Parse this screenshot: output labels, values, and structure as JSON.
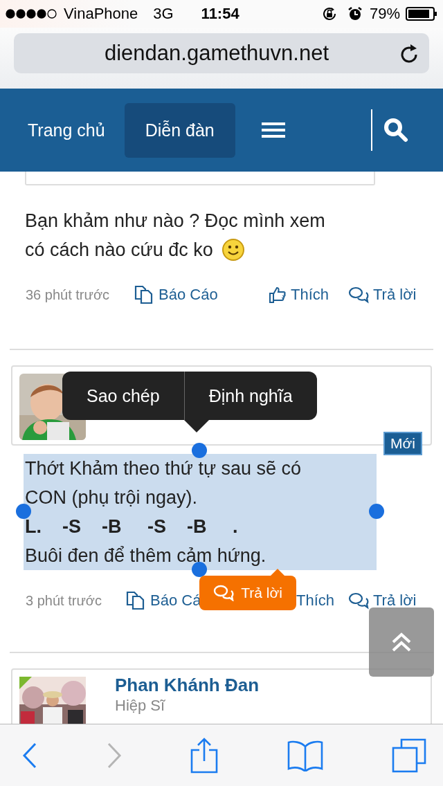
{
  "status_bar": {
    "carrier": "VinaPhone",
    "network": "3G",
    "time": "11:54",
    "battery": "79%"
  },
  "address_bar": {
    "url": "diendan.gamethuvn.net"
  },
  "nav": [
    {
      "label": "Trang chủ",
      "selected": false
    },
    {
      "label": "Diễn đàn",
      "selected": true
    }
  ],
  "posts": [
    {
      "kind": "body",
      "selected": false,
      "lines": [
        {
          "text": "Bạn khảm như nào ? Đọc mình xem",
          "kind": "plain"
        },
        {
          "text": "có cách nào cứu đc ko",
          "kind": "emoji"
        }
      ],
      "time": "36 phút trước",
      "actions": [
        "Báo Cáo",
        "Thích",
        "Trả lời"
      ]
    },
    {
      "kind": "full",
      "selected": true,
      "badge": "Mới",
      "lines": [
        {
          "text": "Thớt Khảm theo thứ tự sau sẽ có",
          "kind": "plain"
        },
        {
          "text": "CON (phụ trội ngay).",
          "kind": "plain"
        },
        {
          "text": "L.    -S    -B     -S    -B     .",
          "kind": "bold"
        },
        {
          "text": "Buôi đen để thêm cảm hứng.",
          "kind": "plain"
        }
      ],
      "time": "3 phút trước",
      "actions": [
        "Báo Cá",
        "Thích",
        "Trả lời"
      ]
    },
    {
      "kind": "card",
      "name": "Phan Khánh Đan",
      "rank": "Hiệp Sĩ"
    }
  ],
  "selection_menu": [
    "Sao chép",
    "Định nghĩa"
  ],
  "quick_reply": "Trả lời"
}
